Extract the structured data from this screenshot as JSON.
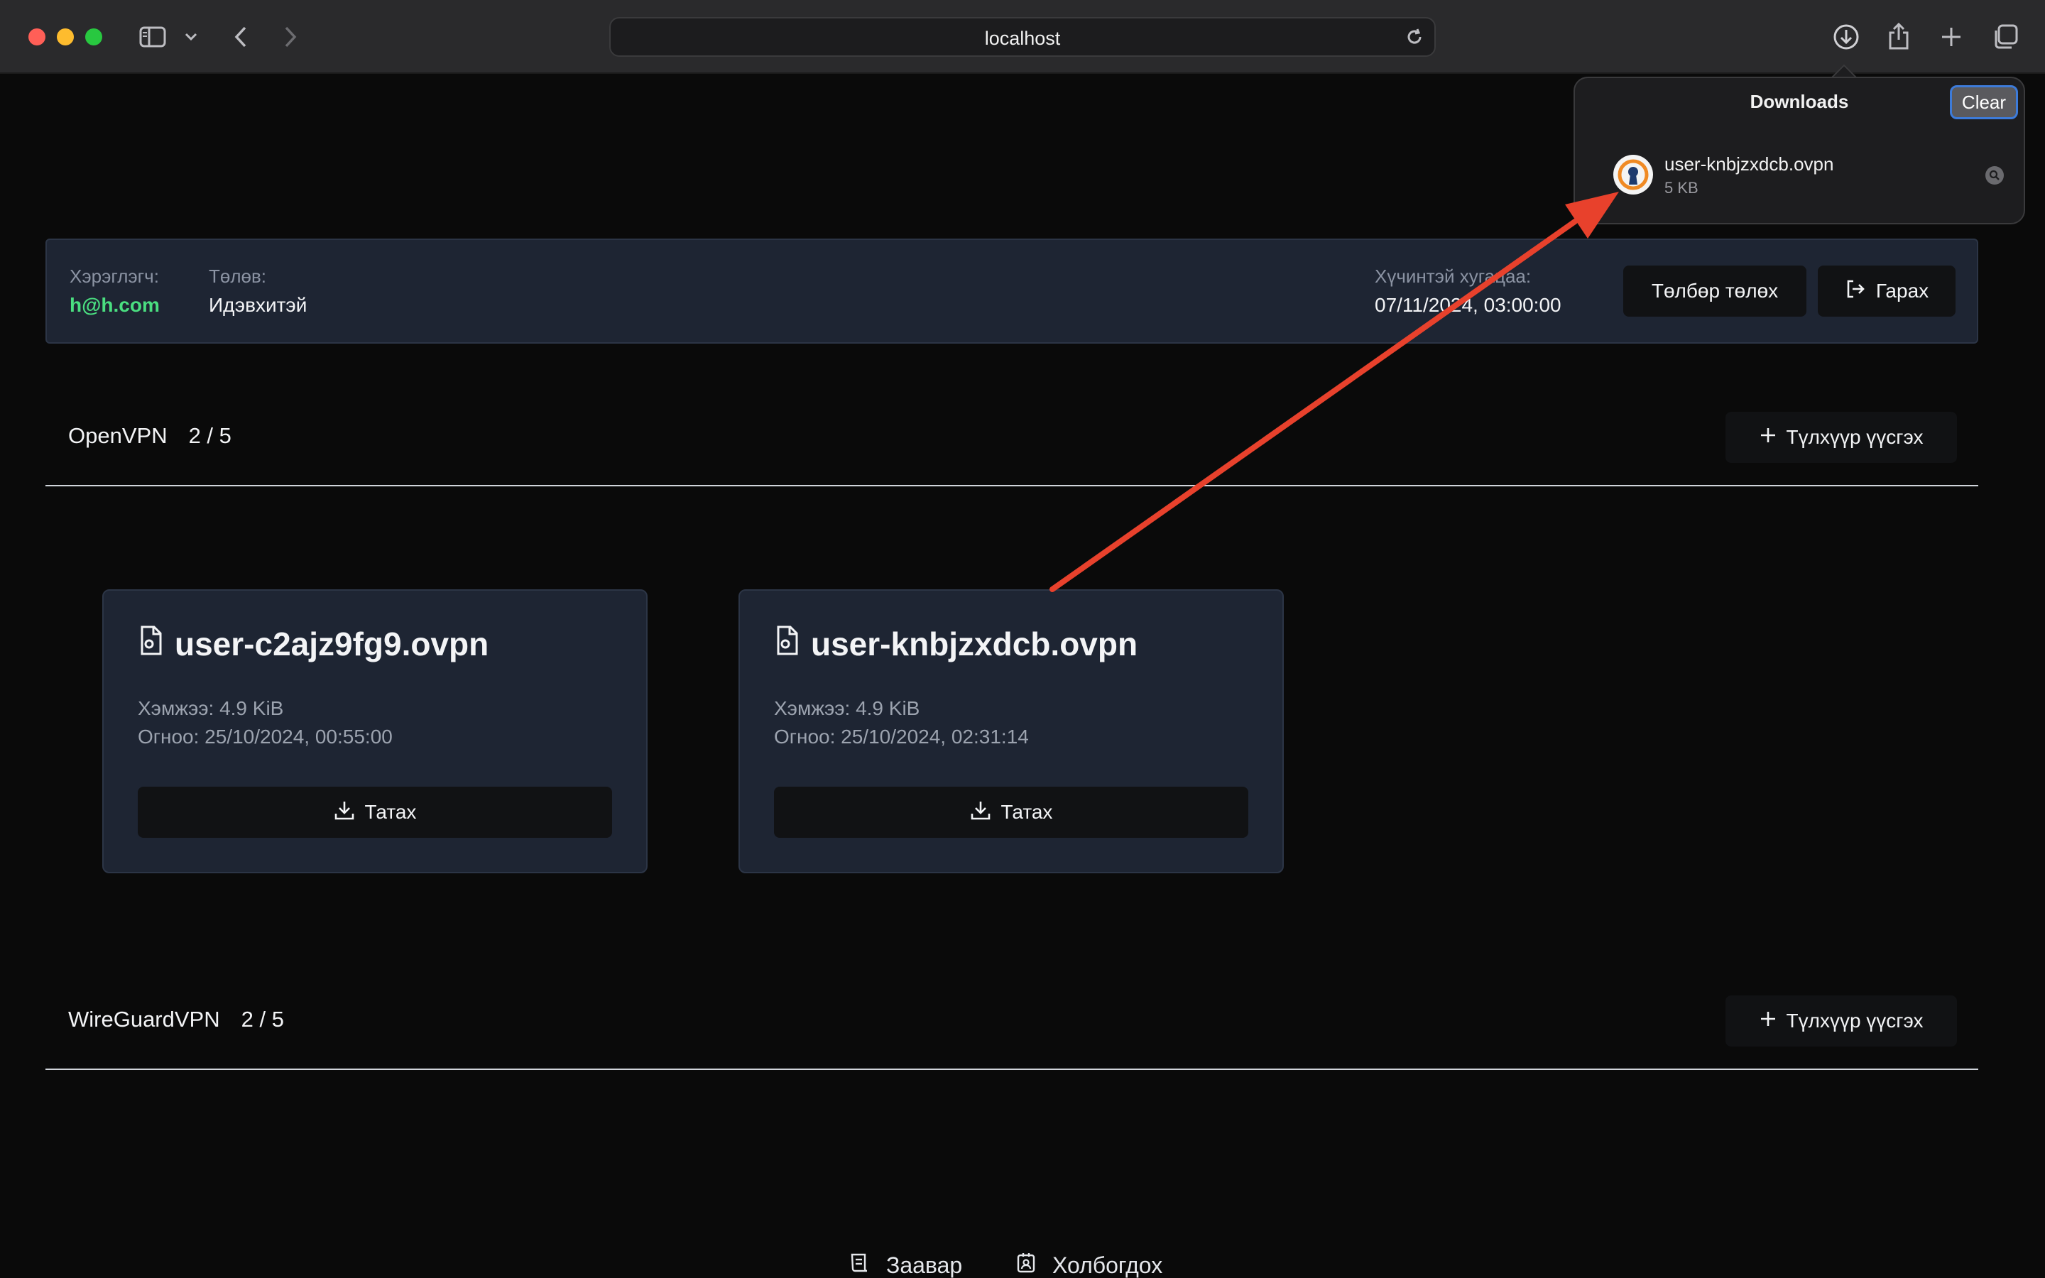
{
  "browser": {
    "address": "localhost",
    "icons": [
      "sidebar-icon",
      "chevron-down-icon",
      "back-icon",
      "forward-icon",
      "reload-icon",
      "downloads-icon",
      "share-icon",
      "new-tab-icon",
      "tab-overview-icon"
    ]
  },
  "downloads": {
    "title": "Downloads",
    "clear_label": "Clear",
    "items": [
      {
        "name": "user-knbjzxdcb.ovpn",
        "size": "5 KB",
        "icon": "openvpn-icon"
      }
    ]
  },
  "user_bar": {
    "user_label": "Хэрэглэгч:",
    "user_value": "h@h.com",
    "payment_label": "Төлөв:",
    "payment_value": "Идэвхитэй",
    "expiry_label": "Хүчинтэй хугацаа:",
    "expiry_value": "07/11/2024, 03:00:00",
    "pay_button": "Төлбөр төлөх",
    "logout_button": "Гарах"
  },
  "sections": [
    {
      "title": "OpenVPN",
      "count": "2 / 5",
      "add_button": "Түлхүүр үүсгэх",
      "cards": [
        {
          "title": "user-c2ajz9fg9.ovpn",
          "size": "Хэмжээ: 4.9 KiB",
          "created": "Огноо: 25/10/2024, 00:55:00",
          "download": "Татах"
        },
        {
          "title": "user-knbjzxdcb.ovpn",
          "size": "Хэмжээ: 4.9 KiB",
          "created": "Огноо: 25/10/2024, 02:31:14",
          "download": "Татах"
        }
      ]
    },
    {
      "title": "WireGuardVPN",
      "count": "2 / 5",
      "add_button": "Түлхүүр үүсгэх",
      "cards": []
    }
  ],
  "footer": {
    "guide_label": "Заавар",
    "contact_label": "Холбогдох"
  },
  "colors": {
    "accent_green": "#4ade80",
    "annotation_arrow": "#e8412c",
    "card_bg": "#1e2533"
  }
}
